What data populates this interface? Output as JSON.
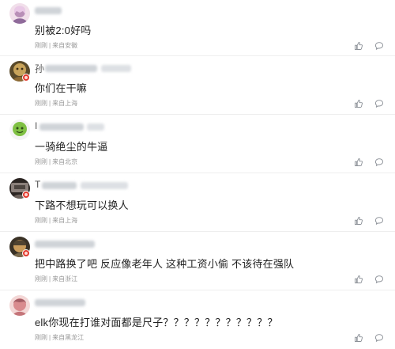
{
  "comments": [
    {
      "id": "c1",
      "username_visible": "",
      "text": "别被2:0好吗",
      "time": "刚刚",
      "location": "来自安徽",
      "avatar_colors": [
        "#b98fb7",
        "#f1dfea"
      ],
      "has_badge": false,
      "like_icon": "thumbs-up-icon",
      "reply_icon": "comment-bubble-icon"
    },
    {
      "id": "c2",
      "username_visible": "孙",
      "text": "你们在干嘛",
      "time": "刚刚",
      "location": "来自上海",
      "avatar_colors": [
        "#c8a35a",
        "#5a4a2a"
      ],
      "has_badge": true,
      "like_icon": "thumbs-up-icon",
      "reply_icon": "comment-bubble-icon"
    },
    {
      "id": "c3",
      "username_visible": "I",
      "text": "一骑绝尘的牛逼",
      "time": "刚刚",
      "location": "来自北京",
      "avatar_colors": [
        "#7fc043",
        "#f4f4f4"
      ],
      "has_badge": false,
      "like_icon": "thumbs-up-icon",
      "reply_icon": "comment-bubble-icon"
    },
    {
      "id": "c4",
      "username_visible": "T",
      "text": "下路不想玩可以换人",
      "time": "刚刚",
      "location": "来自上海",
      "avatar_colors": [
        "#8a7f7a",
        "#2b2522"
      ],
      "has_badge": true,
      "like_icon": "thumbs-up-icon",
      "reply_icon": "comment-bubble-icon"
    },
    {
      "id": "c5",
      "username_visible": "",
      "text": "把中路换了吧 反应像老年人 这种工资小偷 不该待在强队",
      "time": "刚刚",
      "location": "来自浙江",
      "avatar_colors": [
        "#c89b5b",
        "#3a3226"
      ],
      "has_badge": true,
      "like_icon": "thumbs-up-icon",
      "reply_icon": "comment-bubble-icon"
    },
    {
      "id": "c6",
      "username_visible": "",
      "text": "elk你现在打谁对面都是尺子？？？？？？？？？？？",
      "time": "刚刚",
      "location": "来自黑龙江",
      "avatar_colors": [
        "#d98b8e",
        "#f3d7d6"
      ],
      "has_badge": false,
      "like_icon": "thumbs-up-icon",
      "reply_icon": "comment-bubble-icon"
    }
  ]
}
